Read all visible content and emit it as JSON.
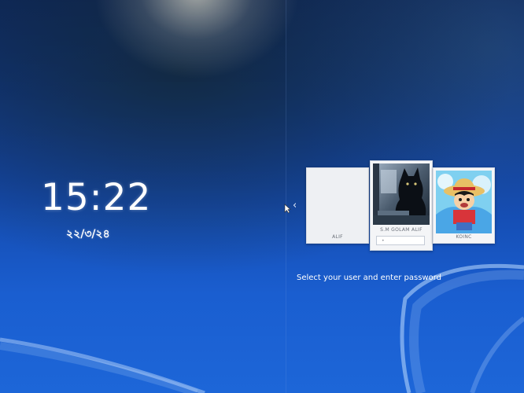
{
  "clock": {
    "time": "15:22",
    "date": "২২/৩/২৪"
  },
  "users": [
    {
      "name": "ALIF",
      "avatar": "blank"
    },
    {
      "name": "S.M GOLAM ALIF",
      "avatar": "black-cat-photo",
      "password_value": "•"
    },
    {
      "name": "KOINC",
      "avatar": "anime-straw-hat-character"
    }
  ],
  "navigation": {
    "prev_icon": "chevron-left-icon",
    "pointer_icon": "mouse-pointer-icon"
  },
  "prompt": "Select your user and enter password",
  "colors": {
    "background": "#1346a6",
    "tile": "#f4f5f7",
    "text": "#ffffff"
  }
}
